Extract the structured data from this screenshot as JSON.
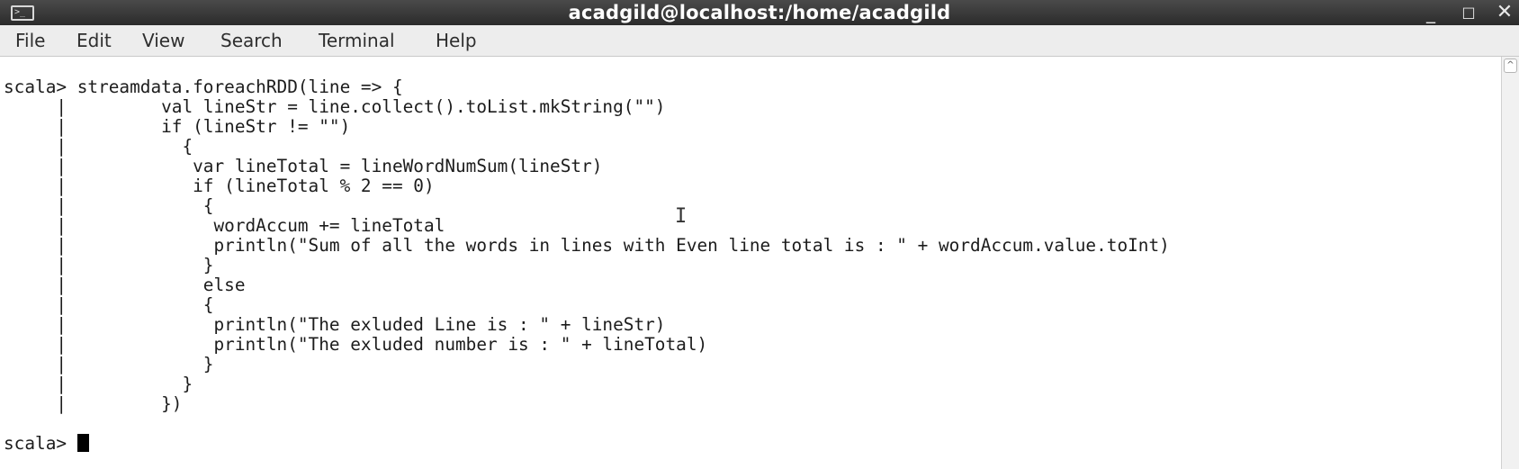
{
  "window": {
    "title": "acadgild@localhost:/home/acadgild",
    "icon": "terminal-icon",
    "controls": {
      "minimize": "_",
      "maximize": "□",
      "close": "✕"
    }
  },
  "menu": {
    "items": [
      "File",
      "Edit",
      "View",
      "Search",
      "Terminal",
      "Help"
    ]
  },
  "terminal": {
    "lines": [
      "scala> streamdata.foreachRDD(line => {",
      "     |         val lineStr = line.collect().toList.mkString(\"\")",
      "     |         if (lineStr != \"\")",
      "     |           {",
      "     |            var lineTotal = lineWordNumSum(lineStr)",
      "     |            if (lineTotal % 2 == 0)",
      "     |             {",
      "     |              wordAccum += lineTotal",
      "     |              println(\"Sum of all the words in lines with Even line total is : \" + wordAccum.value.toInt)",
      "     |             }",
      "     |             else",
      "     |             {",
      "     |              println(\"The exluded Line is : \" + lineStr)",
      "     |              println(\"The exluded number is : \" + lineTotal)",
      "     |             }",
      "     |           }",
      "     |         })",
      "",
      "scala> "
    ]
  },
  "scrollbar": {
    "up_arrow": "^"
  },
  "colors": {
    "titlebar": "#2b2b2b",
    "menubar": "#ededed",
    "terminal_bg": "#ffffff",
    "terminal_fg": "#1c1c1c"
  }
}
